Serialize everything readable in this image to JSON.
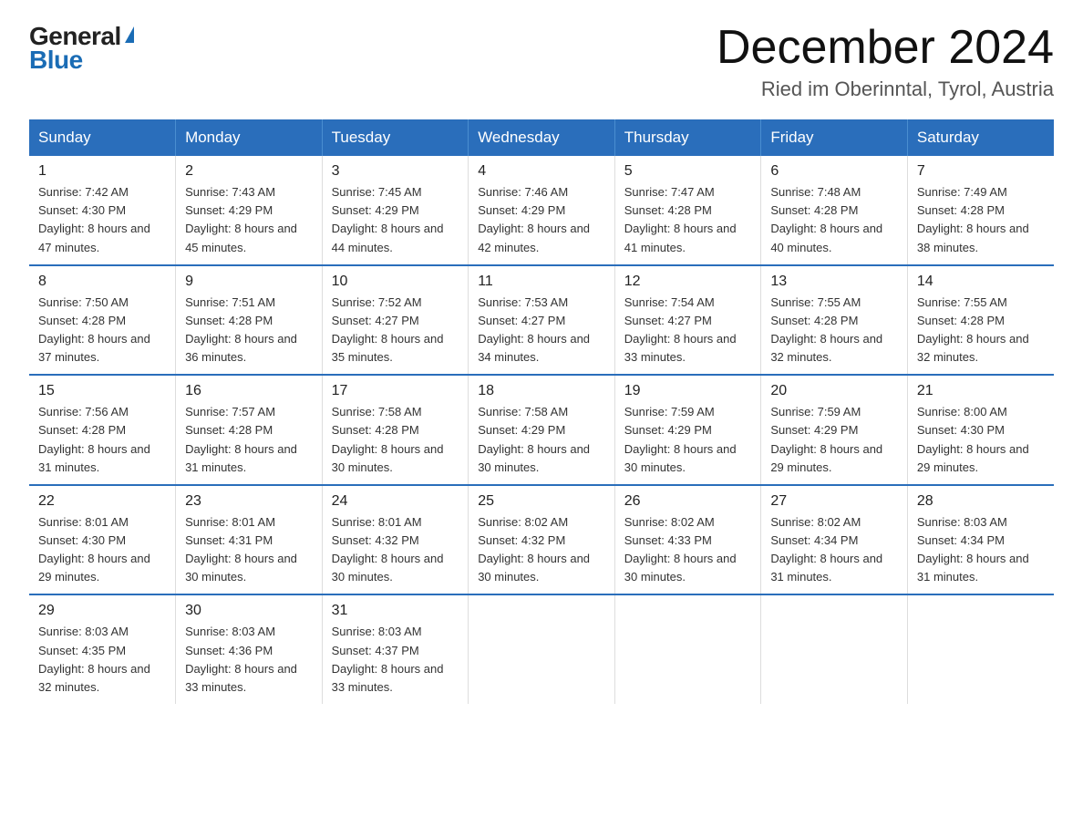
{
  "header": {
    "logo_general": "General",
    "logo_blue": "Blue",
    "month_title": "December 2024",
    "location": "Ried im Oberinntal, Tyrol, Austria"
  },
  "weekdays": [
    "Sunday",
    "Monday",
    "Tuesday",
    "Wednesday",
    "Thursday",
    "Friday",
    "Saturday"
  ],
  "weeks": [
    [
      {
        "day": "1",
        "sunrise": "7:42 AM",
        "sunset": "4:30 PM",
        "daylight": "8 hours and 47 minutes."
      },
      {
        "day": "2",
        "sunrise": "7:43 AM",
        "sunset": "4:29 PM",
        "daylight": "8 hours and 45 minutes."
      },
      {
        "day": "3",
        "sunrise": "7:45 AM",
        "sunset": "4:29 PM",
        "daylight": "8 hours and 44 minutes."
      },
      {
        "day": "4",
        "sunrise": "7:46 AM",
        "sunset": "4:29 PM",
        "daylight": "8 hours and 42 minutes."
      },
      {
        "day": "5",
        "sunrise": "7:47 AM",
        "sunset": "4:28 PM",
        "daylight": "8 hours and 41 minutes."
      },
      {
        "day": "6",
        "sunrise": "7:48 AM",
        "sunset": "4:28 PM",
        "daylight": "8 hours and 40 minutes."
      },
      {
        "day": "7",
        "sunrise": "7:49 AM",
        "sunset": "4:28 PM",
        "daylight": "8 hours and 38 minutes."
      }
    ],
    [
      {
        "day": "8",
        "sunrise": "7:50 AM",
        "sunset": "4:28 PM",
        "daylight": "8 hours and 37 minutes."
      },
      {
        "day": "9",
        "sunrise": "7:51 AM",
        "sunset": "4:28 PM",
        "daylight": "8 hours and 36 minutes."
      },
      {
        "day": "10",
        "sunrise": "7:52 AM",
        "sunset": "4:27 PM",
        "daylight": "8 hours and 35 minutes."
      },
      {
        "day": "11",
        "sunrise": "7:53 AM",
        "sunset": "4:27 PM",
        "daylight": "8 hours and 34 minutes."
      },
      {
        "day": "12",
        "sunrise": "7:54 AM",
        "sunset": "4:27 PM",
        "daylight": "8 hours and 33 minutes."
      },
      {
        "day": "13",
        "sunrise": "7:55 AM",
        "sunset": "4:28 PM",
        "daylight": "8 hours and 32 minutes."
      },
      {
        "day": "14",
        "sunrise": "7:55 AM",
        "sunset": "4:28 PM",
        "daylight": "8 hours and 32 minutes."
      }
    ],
    [
      {
        "day": "15",
        "sunrise": "7:56 AM",
        "sunset": "4:28 PM",
        "daylight": "8 hours and 31 minutes."
      },
      {
        "day": "16",
        "sunrise": "7:57 AM",
        "sunset": "4:28 PM",
        "daylight": "8 hours and 31 minutes."
      },
      {
        "day": "17",
        "sunrise": "7:58 AM",
        "sunset": "4:28 PM",
        "daylight": "8 hours and 30 minutes."
      },
      {
        "day": "18",
        "sunrise": "7:58 AM",
        "sunset": "4:29 PM",
        "daylight": "8 hours and 30 minutes."
      },
      {
        "day": "19",
        "sunrise": "7:59 AM",
        "sunset": "4:29 PM",
        "daylight": "8 hours and 30 minutes."
      },
      {
        "day": "20",
        "sunrise": "7:59 AM",
        "sunset": "4:29 PM",
        "daylight": "8 hours and 29 minutes."
      },
      {
        "day": "21",
        "sunrise": "8:00 AM",
        "sunset": "4:30 PM",
        "daylight": "8 hours and 29 minutes."
      }
    ],
    [
      {
        "day": "22",
        "sunrise": "8:01 AM",
        "sunset": "4:30 PM",
        "daylight": "8 hours and 29 minutes."
      },
      {
        "day": "23",
        "sunrise": "8:01 AM",
        "sunset": "4:31 PM",
        "daylight": "8 hours and 30 minutes."
      },
      {
        "day": "24",
        "sunrise": "8:01 AM",
        "sunset": "4:32 PM",
        "daylight": "8 hours and 30 minutes."
      },
      {
        "day": "25",
        "sunrise": "8:02 AM",
        "sunset": "4:32 PM",
        "daylight": "8 hours and 30 minutes."
      },
      {
        "day": "26",
        "sunrise": "8:02 AM",
        "sunset": "4:33 PM",
        "daylight": "8 hours and 30 minutes."
      },
      {
        "day": "27",
        "sunrise": "8:02 AM",
        "sunset": "4:34 PM",
        "daylight": "8 hours and 31 minutes."
      },
      {
        "day": "28",
        "sunrise": "8:03 AM",
        "sunset": "4:34 PM",
        "daylight": "8 hours and 31 minutes."
      }
    ],
    [
      {
        "day": "29",
        "sunrise": "8:03 AM",
        "sunset": "4:35 PM",
        "daylight": "8 hours and 32 minutes."
      },
      {
        "day": "30",
        "sunrise": "8:03 AM",
        "sunset": "4:36 PM",
        "daylight": "8 hours and 33 minutes."
      },
      {
        "day": "31",
        "sunrise": "8:03 AM",
        "sunset": "4:37 PM",
        "daylight": "8 hours and 33 minutes."
      },
      null,
      null,
      null,
      null
    ]
  ],
  "labels": {
    "sunrise": "Sunrise:",
    "sunset": "Sunset:",
    "daylight": "Daylight:"
  }
}
